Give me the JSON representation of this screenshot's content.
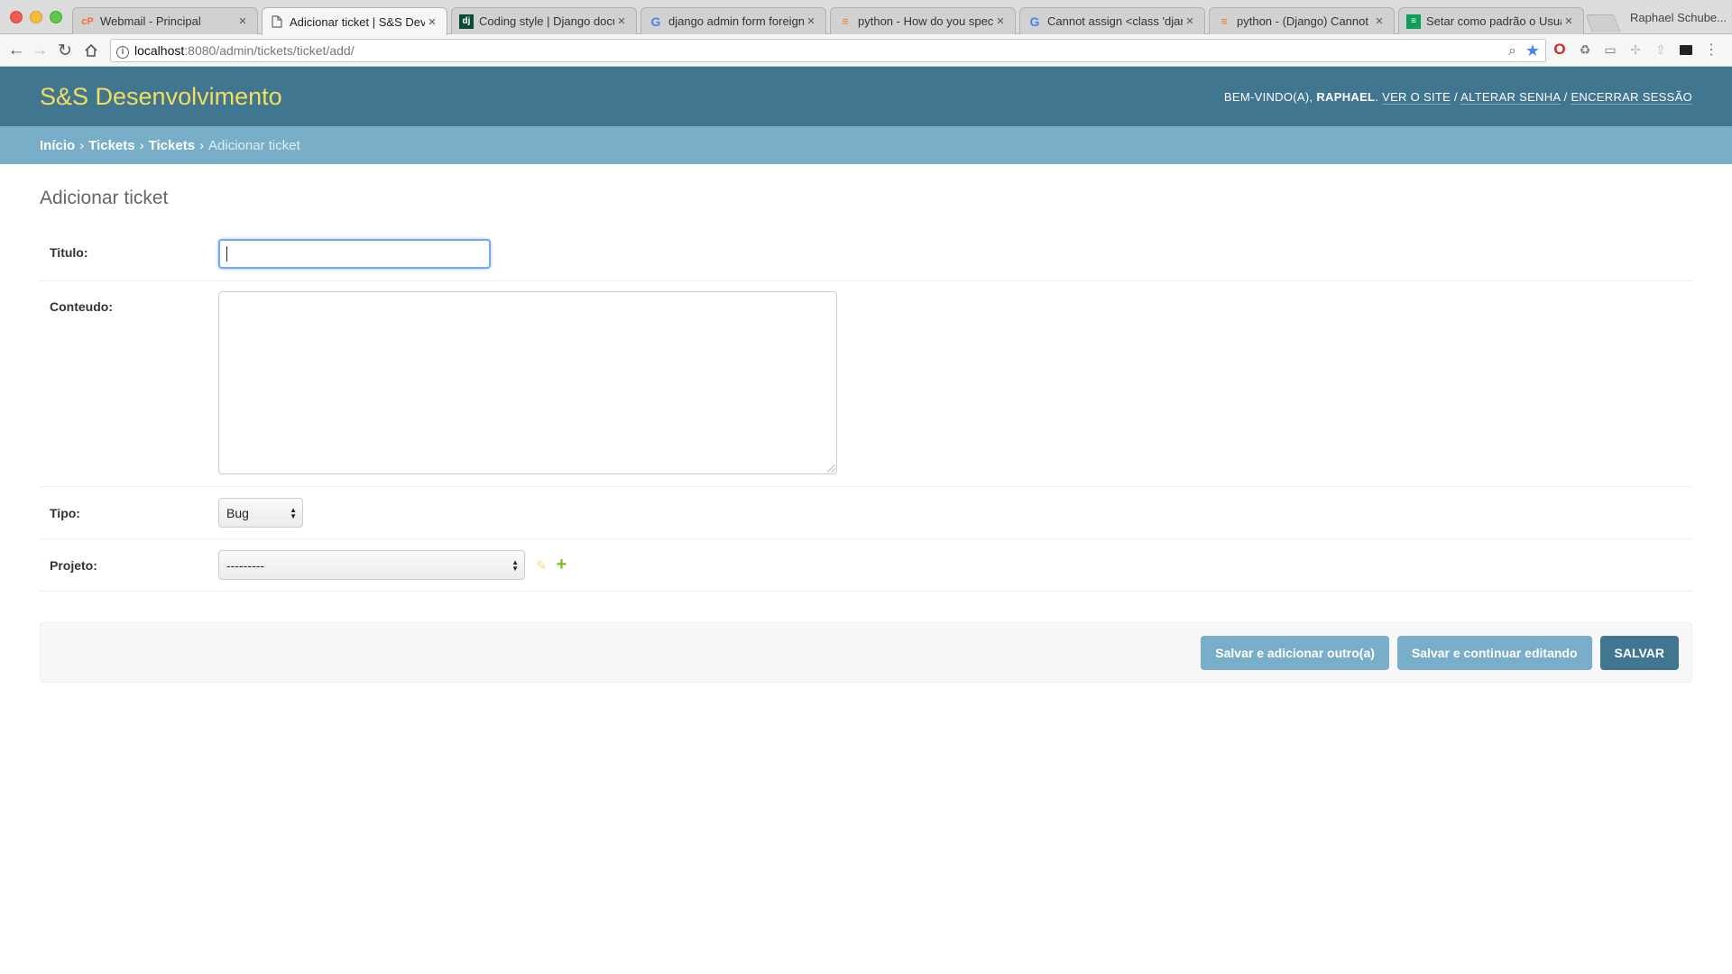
{
  "browser": {
    "tabs": [
      {
        "title": "Webmail - Principal",
        "favicon": "cp",
        "favicon_color": "#ff6c2c"
      },
      {
        "title": "Adicionar ticket | S&S Dev",
        "favicon": "page-icon",
        "favicon_color": "#555555",
        "active": true
      },
      {
        "title": "Coding style | Django docu",
        "favicon": "dj",
        "favicon_color": "#0c4b33"
      },
      {
        "title": "django admin form foreign",
        "favicon": "G",
        "favicon_color": "#4285f4"
      },
      {
        "title": "python - How do you speci",
        "favicon": "stackoverflow-icon",
        "favicon_color": "#f48024"
      },
      {
        "title": "Cannot assign <class 'djang",
        "favicon": "G",
        "favicon_color": "#4285f4"
      },
      {
        "title": "python - (Django) Cannot a",
        "favicon": "stackoverflow-icon",
        "favicon_color": "#f48024"
      },
      {
        "title": "Setar como padrão o Usuar",
        "favicon": "sheet-icon",
        "favicon_color": "#0f9d58"
      }
    ],
    "profile_name": "Raphael Schube...",
    "url_host": "localhost",
    "url_path": ":8080/admin/tickets/ticket/add/"
  },
  "header": {
    "branding": "S&S Desenvolvimento",
    "welcome": "Bem-vindo(a),",
    "username": "Raphael",
    "links": {
      "view_site": "Ver o site",
      "change_password": "Alterar senha",
      "logout": "Encerrar sessão"
    }
  },
  "breadcrumbs": {
    "home": "Início",
    "app": "Tickets",
    "model": "Tickets",
    "current": "Adicionar ticket"
  },
  "form": {
    "title": "Adicionar ticket",
    "fields": {
      "titulo": {
        "label": "Titulo:",
        "value": ""
      },
      "conteudo": {
        "label": "Conteudo:",
        "value": ""
      },
      "tipo": {
        "label": "Tipo:",
        "value": "Bug"
      },
      "projeto": {
        "label": "Projeto:",
        "value": "---------"
      }
    }
  },
  "submit": {
    "save_add_another": "Salvar e adicionar outro(a)",
    "save_continue": "Salvar e continuar editando",
    "save": "Salvar"
  },
  "colors": {
    "header_bg": "#417690",
    "breadcrumbs_bg": "#79aec8",
    "branding": "#f5dd5d"
  }
}
